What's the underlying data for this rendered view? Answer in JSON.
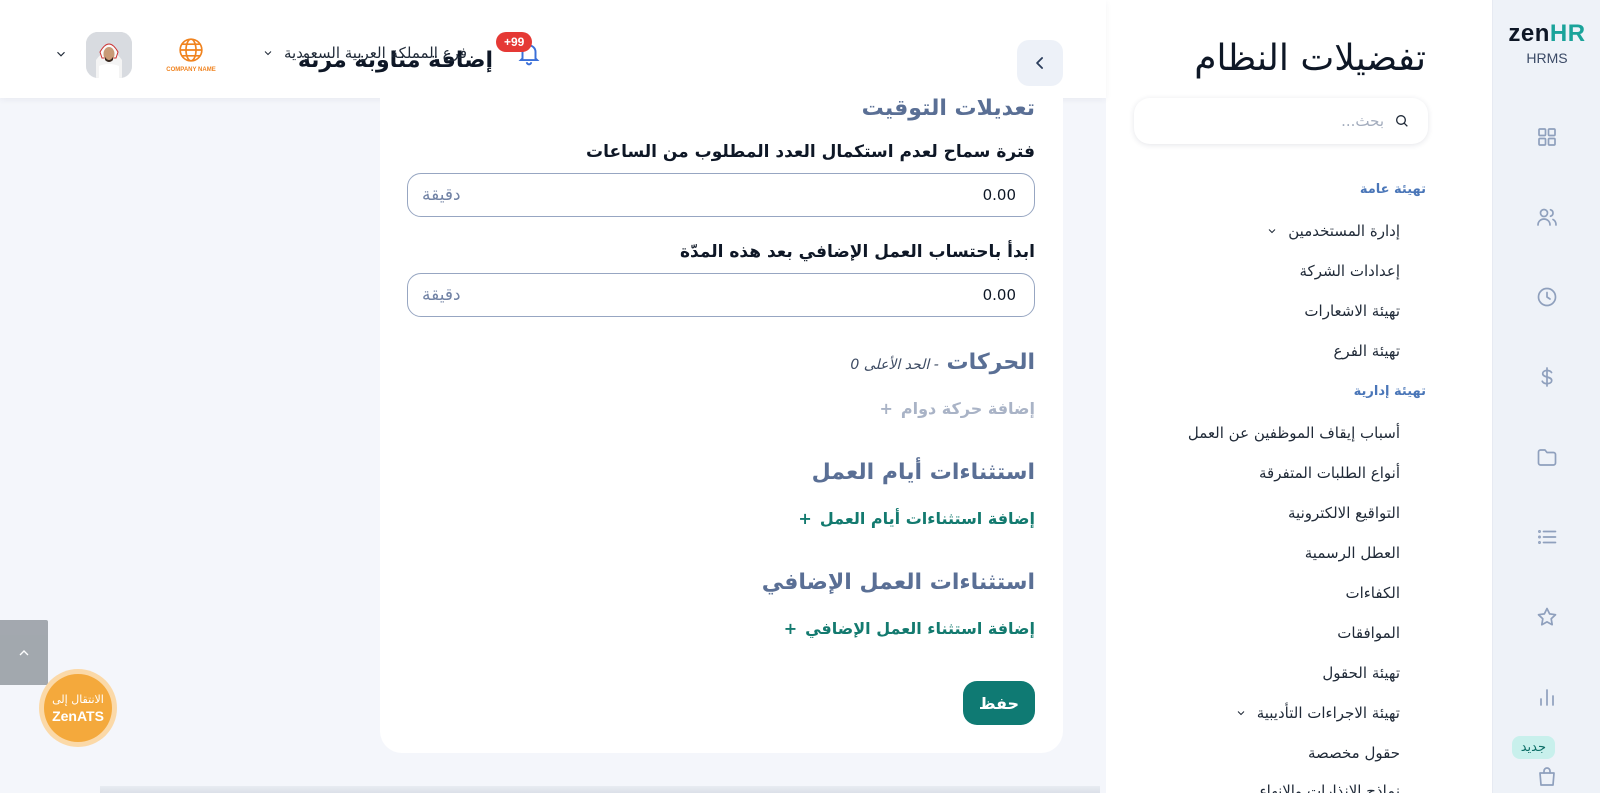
{
  "brand": {
    "name_part1": "zen",
    "name_part2": "HR",
    "subtitle": "HRMS",
    "new_badge": "جديد"
  },
  "rail": {
    "icons": [
      "dashboard-icon",
      "users-icon",
      "clock-icon",
      "dollar-icon",
      "folder-icon",
      "list-icon",
      "star-icon",
      "bar-chart-icon",
      "bag-icon"
    ]
  },
  "settings": {
    "title": "تفضيلات النظام",
    "search_placeholder": "بحث...",
    "sections": [
      {
        "label": "تهيئة عامة"
      },
      {
        "label": "تهيئة إدارية"
      }
    ],
    "items": [
      {
        "label": "إدارة المستخدمين",
        "has_chevron": true
      },
      {
        "label": "إعدادات الشركة"
      },
      {
        "label": "تهيئة الاشعارات"
      },
      {
        "label": "تهيئة الفرع"
      },
      {
        "label": "أسباب إيقاف الموظفين عن العمل"
      },
      {
        "label": "أنواع الطلبات المتفرقة"
      },
      {
        "label": "التواقيع الالكترونية"
      },
      {
        "label": "العطل الرسمية"
      },
      {
        "label": "الكفاءات"
      },
      {
        "label": "الموافقات"
      },
      {
        "label": "تهيئة الحقول"
      },
      {
        "label": "تهيئة الاجراءات التأديبية",
        "has_chevron": true
      },
      {
        "label": "حقول مخصصة"
      },
      {
        "label": "نماذج الانذارات والانهاء"
      }
    ]
  },
  "header": {
    "title": "إضافة مناوبة مرنة",
    "notifications_count": "+99",
    "branch": "فرع المملكة العربية السعودية",
    "company_logo_text": "COMPANY NAME"
  },
  "form": {
    "timing_title": "تعديلات التوقيت",
    "grace_label": "فترة سماح لعدم استكمال العدد المطلوب من الساعات",
    "grace_value": "0.00",
    "grace_unit": "دقيقة",
    "overtime_label": "ابدأ باحتساب العمل الإضافي بعد هذه المدّة",
    "overtime_value": "0.00",
    "overtime_unit": "دقيقة",
    "movements_title": "الحركات",
    "movements_sub": "- الحد الأعلى 0",
    "add_movement": "إضافة حركة دوام",
    "workday_exceptions_title": "استثناءات أيام العمل",
    "add_workday_exception": "إضافة استثناءات أيام العمل",
    "overtime_exceptions_title": "استثناءات العمل الإضافي",
    "add_overtime_exception": "إضافة استثناء العمل الإضافي",
    "save_label": "حفظ"
  },
  "floating": {
    "zenats_line1": "الانتقال إلى",
    "zenats_line2": "ZenATS"
  },
  "colors": {
    "accent": "#0f7a73",
    "notification": "#e53935",
    "zenats": "#f4a93c"
  }
}
